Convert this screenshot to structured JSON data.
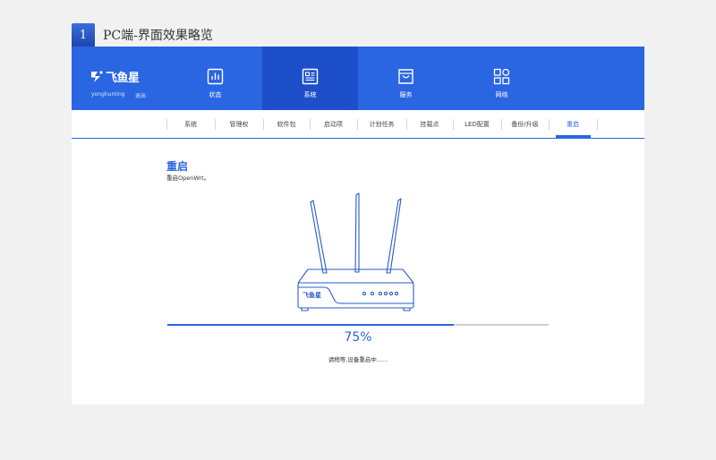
{
  "section": {
    "number": "1",
    "title": "PC端-界面效果略览"
  },
  "brand": {
    "name": "飞鱼星",
    "username": "yonghuming",
    "logout": "退出"
  },
  "nav": [
    {
      "label": "状态",
      "icon": "status-chart-icon",
      "active": false
    },
    {
      "label": "系统",
      "icon": "system-list-icon",
      "active": true
    },
    {
      "label": "服务",
      "icon": "service-bag-icon",
      "active": false
    },
    {
      "label": "网络",
      "icon": "network-nodes-icon",
      "active": false
    }
  ],
  "subnav": [
    {
      "label": "系统"
    },
    {
      "label": "管理权"
    },
    {
      "label": "软件包"
    },
    {
      "label": "启动项"
    },
    {
      "label": "计划任务"
    },
    {
      "label": "挂载点"
    },
    {
      "label": "LED配置"
    },
    {
      "label": "备份/升级"
    },
    {
      "label": "重启",
      "active": true
    }
  ],
  "page": {
    "title": "重启",
    "description": "重启OpenWrt。",
    "router_brand": "飞鱼星",
    "progress": 75,
    "progress_label": "75%",
    "status": "请稍等,设备重启中......"
  },
  "colors": {
    "primary": "#2a65e2",
    "primary_dark": "#1d4fcb",
    "track": "#cfcfcf"
  }
}
